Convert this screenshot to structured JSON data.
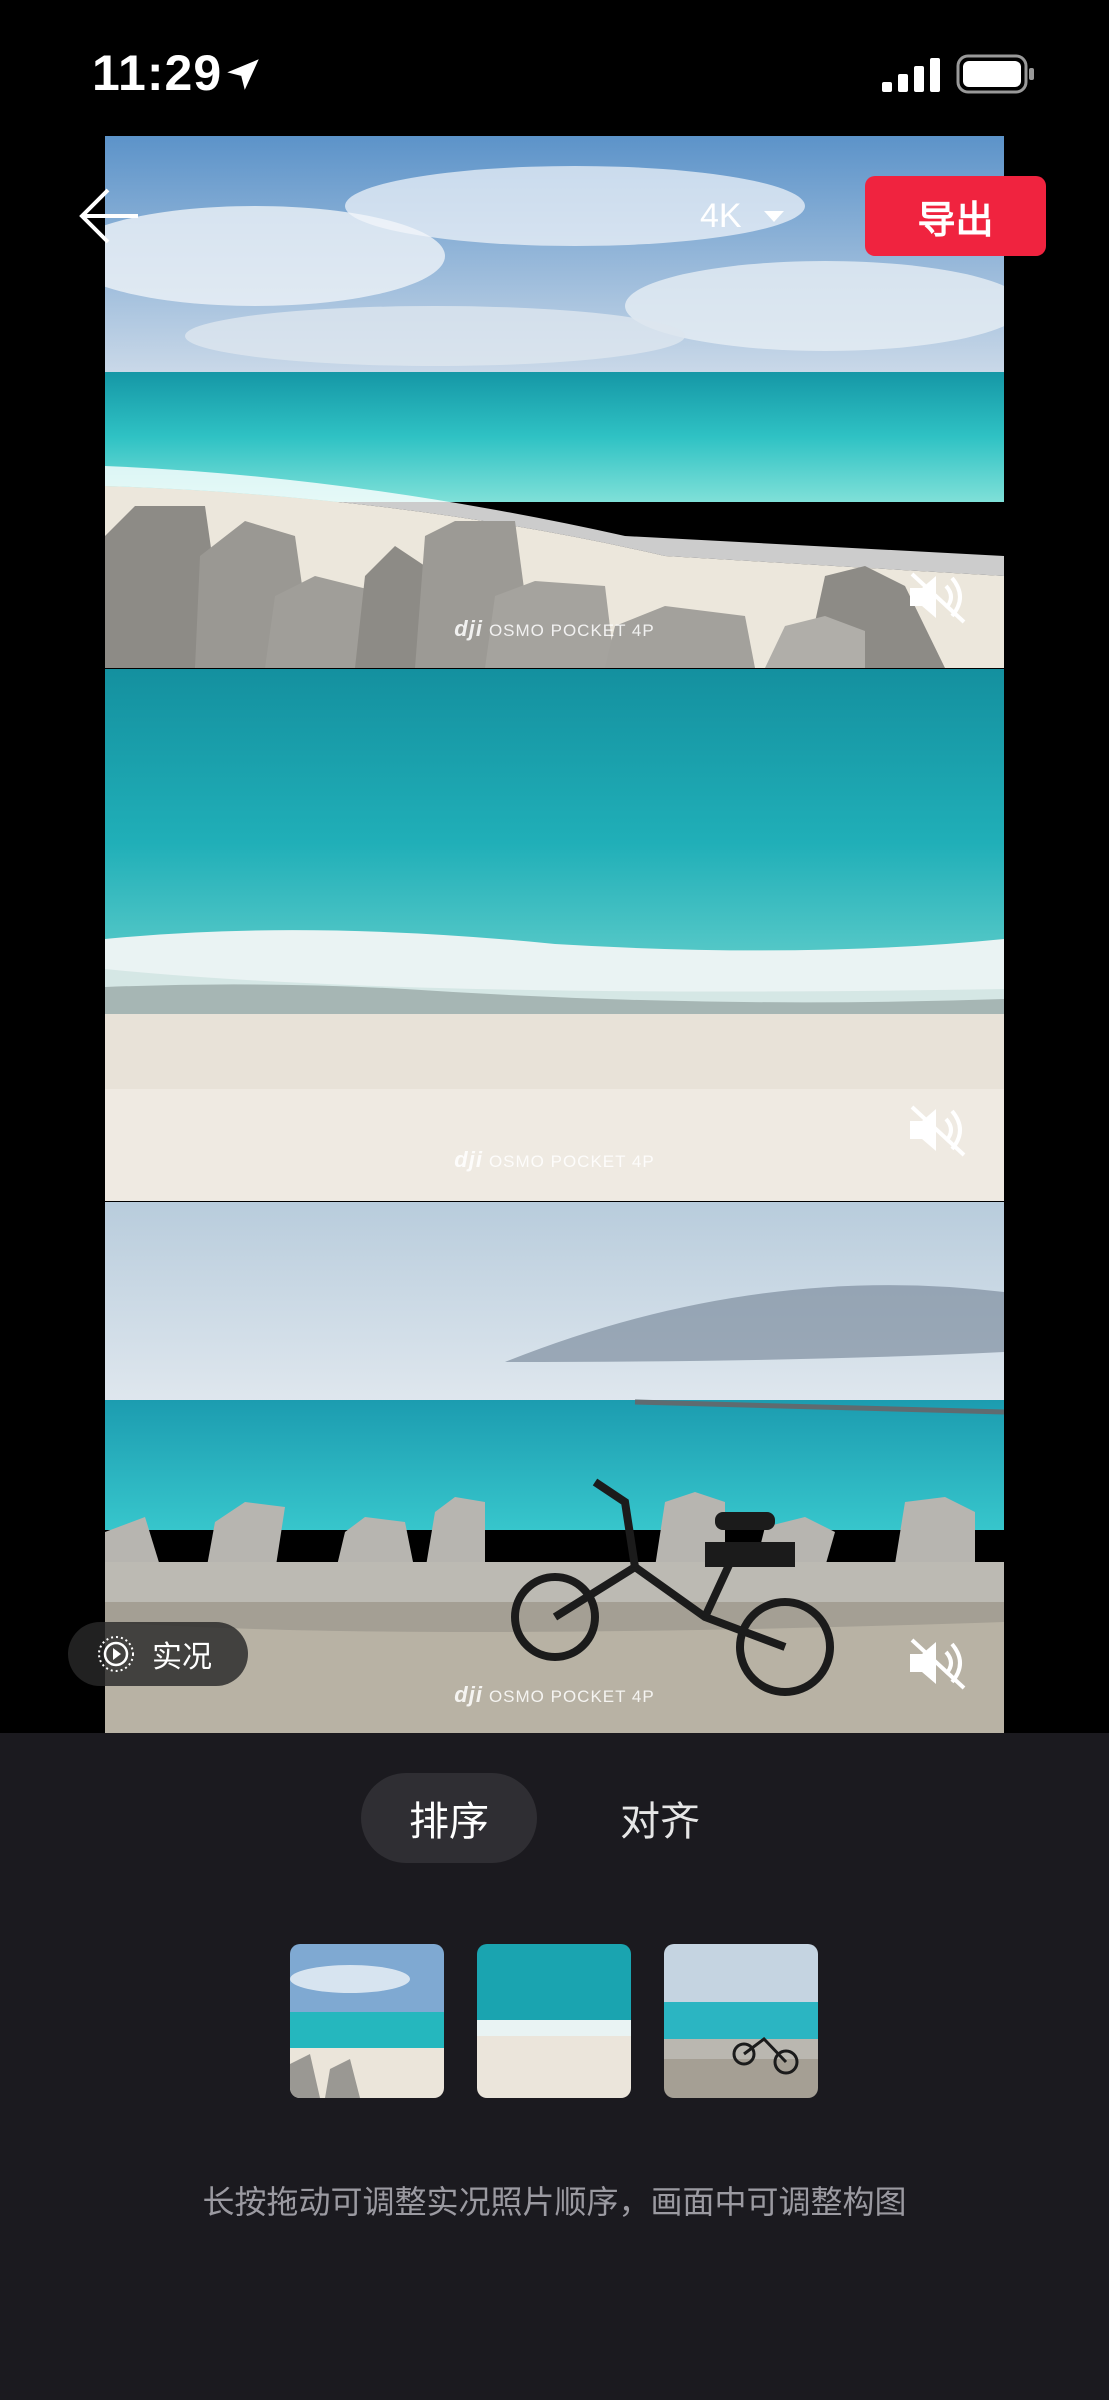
{
  "status_bar": {
    "time": "11:29"
  },
  "header": {
    "resolution": "4K",
    "export_label": "导出"
  },
  "panels": [
    {
      "watermark_brand": "dji",
      "watermark_text": "OSMO POCKET 4P"
    },
    {
      "watermark_brand": "dji",
      "watermark_text": "OSMO POCKET 4P"
    },
    {
      "watermark_brand": "dji",
      "watermark_text": "OSMO POCKET 4P"
    }
  ],
  "live_badge": {
    "label": "实况"
  },
  "tabs": [
    {
      "label": "排序"
    },
    {
      "label": "对齐"
    }
  ],
  "hint": "长按拖动可调整实况照片顺序，画面中可调整构图",
  "colors": {
    "accent": "#f0233f",
    "panel_bg": "#1b1a1f",
    "active_tab_bg": "#2f2e33"
  }
}
